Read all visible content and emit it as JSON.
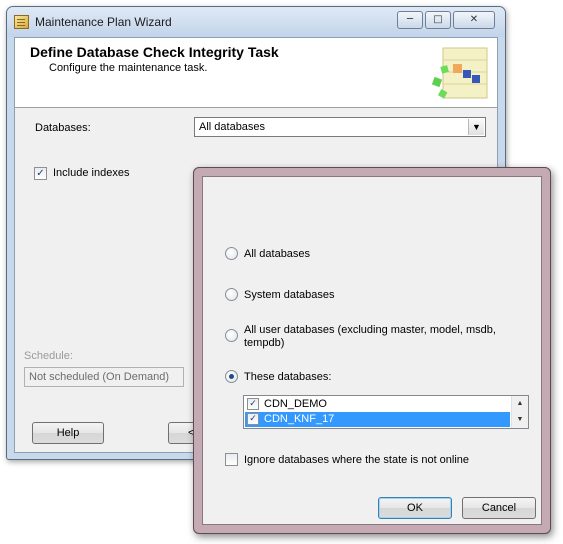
{
  "wizard": {
    "title": "Maintenance Plan Wizard",
    "caption_buttons": {
      "minimize": "─",
      "maximize": "□",
      "close": "✕"
    },
    "header": {
      "title": "Define Database Check Integrity Task",
      "subtitle": "Configure the maintenance task."
    },
    "databases_label": "Databases:",
    "databases_value": "All databases",
    "include_indexes_label": "Include indexes",
    "include_indexes_checked": true,
    "schedule_label": "Schedule:",
    "schedule_value": "Not scheduled (On Demand)",
    "help_button": "Help",
    "back_button_partial": "<"
  },
  "database_picker": {
    "options": [
      {
        "label": "All databases",
        "checked": false
      },
      {
        "label": "System databases",
        "checked": false
      },
      {
        "label": "All user databases  (excluding master, model, msdb,",
        "label_line2": "tempdb)",
        "checked": false
      },
      {
        "label": "These databases:",
        "checked": true
      }
    ],
    "databases": [
      {
        "name": "CDN_DEMO",
        "checked": true,
        "selected": false
      },
      {
        "name": "CDN_KNF_17",
        "checked": true,
        "selected": true
      }
    ],
    "ignore_offline_label": "Ignore databases where the state is not online",
    "ignore_offline_checked": false,
    "ok_button": "OK",
    "cancel_button": "Cancel",
    "scroll_up": "▲",
    "scroll_down": "▼",
    "check_glyph": "✓"
  },
  "icons": {
    "window_icon": "maintenance-plan-icon",
    "header_graphic": "task-graphic-icon",
    "dropdown_arrow": "▼"
  }
}
